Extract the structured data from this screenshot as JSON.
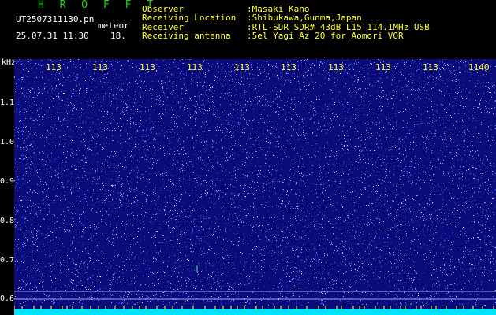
{
  "title": "H R O F F T",
  "filename": "UT2507311130.pn",
  "label_meteor": "meteor",
  "datetime": "25.07.31 11:30",
  "count": "18.",
  "info": [
    {
      "label": "Observer",
      "value": ":Masaki Kano"
    },
    {
      "label": "Receiving Location",
      "value": ":Shibukawa,Gunma,Japan"
    },
    {
      "label": "Receiver",
      "value": ":RTL-SDR SDR# 43dB L15 114.1MHz USB"
    },
    {
      "label": "Receiving antenna",
      "value": ":5el Yagi Az 20 for Aomori VOR"
    }
  ],
  "y_unit": "kHz",
  "y_ticks": [
    "1.1",
    "1.0",
    "0.9",
    "0.8",
    "0.7",
    "0.6"
  ],
  "x_ticks": [
    "113",
    "113",
    "113",
    "113",
    "113",
    "113",
    "113",
    "113",
    "113",
    "1140"
  ],
  "colors": {
    "background": "#0b0b7a",
    "noise": "#3a6cff",
    "bottom_band": "#00e5ff",
    "header_text": "#ffff33",
    "title_text": "#1ecf1e"
  }
}
